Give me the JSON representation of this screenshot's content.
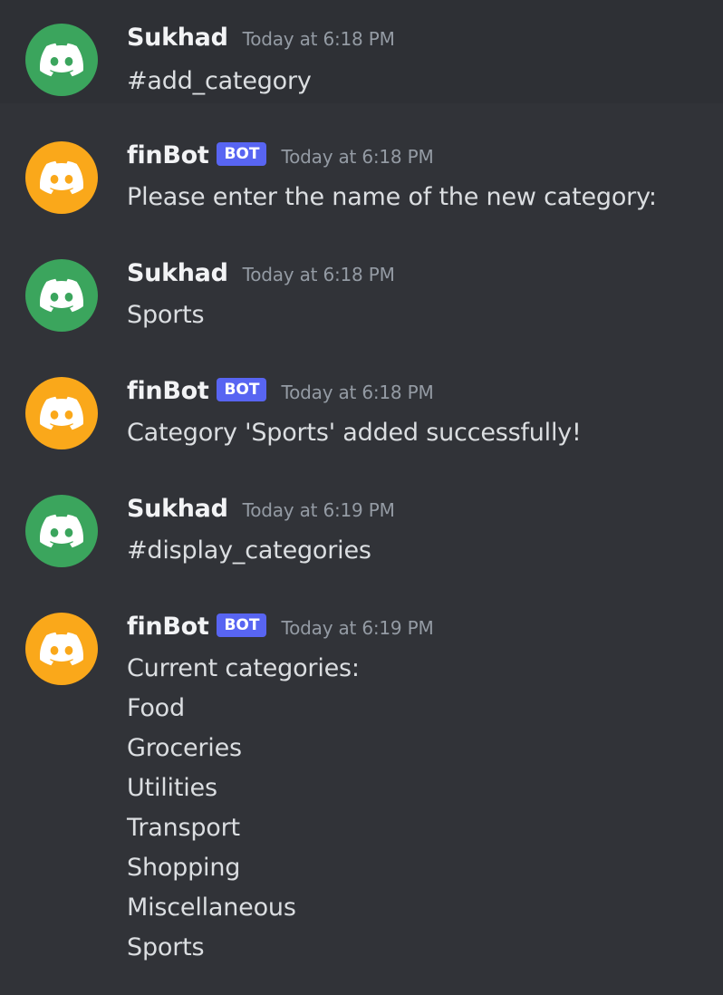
{
  "colors": {
    "background": "#313338",
    "highlight": "#2e3035",
    "user_avatar": "#3ba55d",
    "bot_avatar": "#faa81a",
    "bot_tag": "#5865f2",
    "timestamp": "#949ba4",
    "username": "#f2f3f5",
    "message_text": "#dbdee1"
  },
  "avatar_icon": "discord-logo-icon",
  "messages": [
    {
      "author": "Sukhad",
      "is_bot": false,
      "timestamp": "Today at 6:18 PM",
      "lines": [
        "#add_category"
      ]
    },
    {
      "author": "finBot",
      "is_bot": true,
      "bot_tag": "BOT",
      "timestamp": "Today at 6:18 PM",
      "lines": [
        "Please enter the name of the new category:"
      ]
    },
    {
      "author": "Sukhad",
      "is_bot": false,
      "timestamp": "Today at 6:18 PM",
      "lines": [
        "Sports"
      ]
    },
    {
      "author": "finBot",
      "is_bot": true,
      "bot_tag": "BOT",
      "timestamp": "Today at 6:18 PM",
      "lines": [
        "Category 'Sports' added successfully!"
      ]
    },
    {
      "author": "Sukhad",
      "is_bot": false,
      "timestamp": "Today at 6:19 PM",
      "lines": [
        "#display_categories"
      ]
    },
    {
      "author": "finBot",
      "is_bot": true,
      "bot_tag": "BOT",
      "timestamp": "Today at 6:19 PM",
      "lines": [
        "Current categories:",
        "Food",
        "Groceries",
        "Utilities",
        "Transport",
        "Shopping",
        "Miscellaneous",
        "Sports"
      ]
    }
  ]
}
